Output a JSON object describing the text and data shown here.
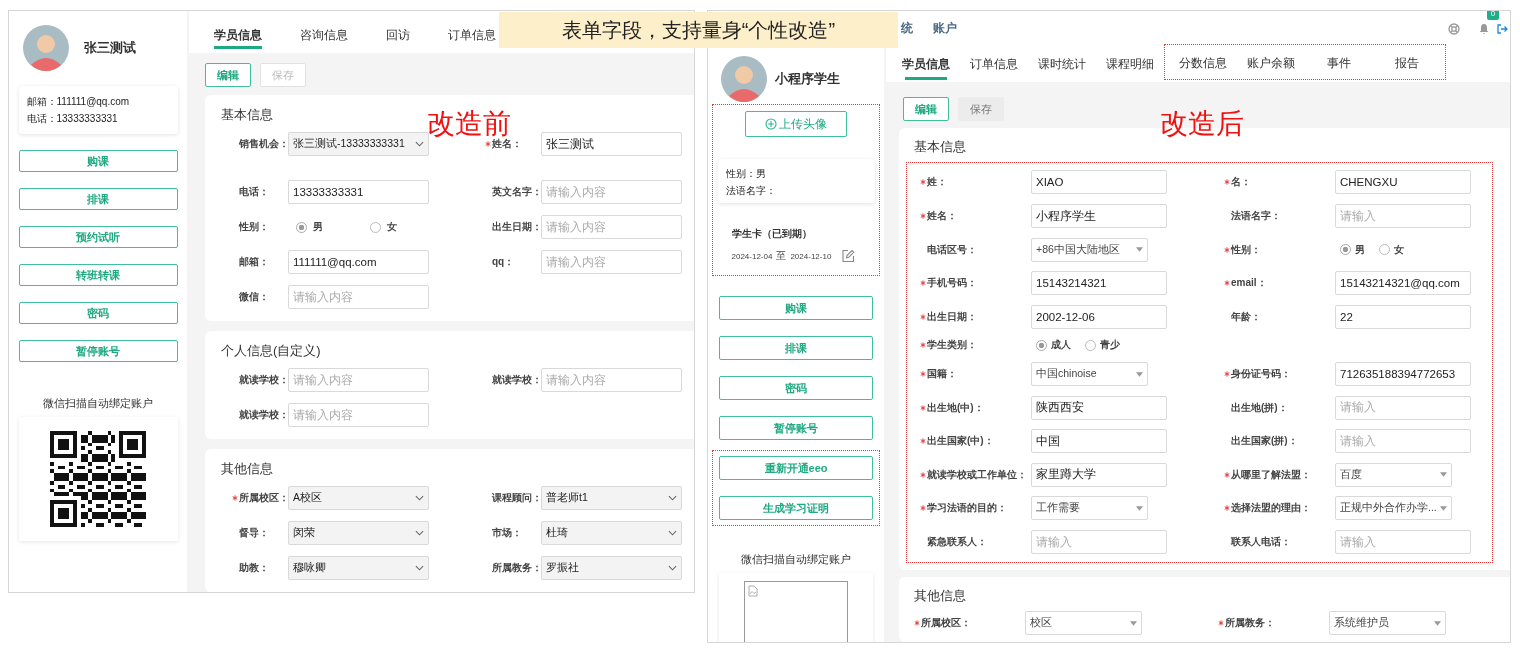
{
  "banner": {
    "text": "表单字段，支持量身“个性改造”"
  },
  "before": {
    "caption": "改造前",
    "profile": {
      "name": "张三测试",
      "info": [
        "邮箱：111111@qq.com",
        "电话：13333333331"
      ]
    },
    "buttons": [
      "购课",
      "排课",
      "预约试听",
      "转班转课",
      "密码",
      "暂停账号"
    ],
    "qr_caption": "微信扫描自动绑定账户",
    "tabs": [
      {
        "label": "学员信息",
        "selected": true
      },
      {
        "label": "咨询信息",
        "selected": false
      },
      {
        "label": "回访",
        "selected": false
      },
      {
        "label": "订单信息",
        "selected": false
      }
    ],
    "toolbar": [
      {
        "label": "编辑",
        "kind": "primary"
      },
      {
        "label": "保存",
        "kind": "disabled"
      }
    ],
    "sections": [
      {
        "title": "基本信息",
        "rows": [
          [
            {
              "label": "销售机会：",
              "kind": "select",
              "required": false,
              "value": "张三测试-13333333331"
            },
            {
              "label": "姓名：",
              "kind": "input",
              "required": true,
              "value": "张三测试"
            }
          ],
          [
            {
              "label": "电话：",
              "kind": "input",
              "required": false,
              "value": "13333333331"
            },
            {
              "label": "英文名字：",
              "kind": "input",
              "required": false,
              "placeholder": "请输入内容"
            }
          ],
          [
            {
              "label": "性别：",
              "kind": "radio",
              "required": false,
              "options": [
                {
                  "label": "男",
                  "selected": true
                },
                {
                  "label": "女",
                  "selected": false
                }
              ]
            },
            {
              "label": "出生日期：",
              "kind": "input",
              "required": false,
              "placeholder": "请输入内容"
            }
          ],
          [
            {
              "label": "邮箱：",
              "kind": "input",
              "required": false,
              "value": "111111@qq.com"
            },
            {
              "label": "qq：",
              "kind": "input",
              "required": false,
              "placeholder": "请输入内容"
            }
          ],
          [
            {
              "label": "微信：",
              "kind": "input",
              "required": false,
              "placeholder": "请输入内容"
            }
          ]
        ]
      },
      {
        "title": "个人信息(自定义)",
        "rows": [
          [
            {
              "label": "就读学校：",
              "kind": "input",
              "required": false,
              "placeholder": "请输入内容"
            },
            {
              "label": "就读学校：",
              "kind": "input",
              "required": false,
              "placeholder": "请输入内容"
            }
          ],
          [
            {
              "label": "就读学校：",
              "kind": "input",
              "required": false,
              "placeholder": "请输入内容"
            }
          ]
        ]
      },
      {
        "title": "其他信息",
        "rows": [
          [
            {
              "label": "所属校区：",
              "kind": "select",
              "required": true,
              "value": "A校区"
            },
            {
              "label": "课程顾问：",
              "kind": "select",
              "required": false,
              "value": "普老师t1"
            }
          ],
          [
            {
              "label": "督导：",
              "kind": "select",
              "required": false,
              "value": "闵荣"
            },
            {
              "label": "市场：",
              "kind": "select",
              "required": false,
              "value": "杜琦"
            }
          ],
          [
            {
              "label": "助教：",
              "kind": "select",
              "required": false,
              "value": "穆咏卿"
            },
            {
              "label": "所属教务：",
              "kind": "select",
              "required": false,
              "value": "罗振社"
            }
          ]
        ]
      }
    ]
  },
  "after": {
    "caption": "改造后",
    "top_nav": [
      "统",
      "账户"
    ],
    "notification_count": "0",
    "profile": {
      "name": "小程序学生"
    },
    "added_profile": {
      "upload_button": "上传头像",
      "info": [
        "性别：男",
        "法语名字："
      ],
      "card_title": "学生卡（已到期）",
      "card_start": "2024-12-04",
      "card_to": "至",
      "card_end": "2024-12-10"
    },
    "buttons": [
      "购课",
      "排课",
      "密码",
      "暂停账号"
    ],
    "added_buttons": [
      "重新开通eeo",
      "生成学习证明"
    ],
    "qr_caption": "微信扫描自动绑定账户",
    "tabs": [
      {
        "label": "学员信息",
        "selected": true
      },
      {
        "label": "订单信息",
        "selected": false
      },
      {
        "label": "课时统计",
        "selected": false
      },
      {
        "label": "课程明细",
        "selected": false
      }
    ],
    "added_tabs": [
      {
        "label": "分数信息",
        "selected": false
      },
      {
        "label": "账户余额",
        "selected": false
      },
      {
        "label": "事件",
        "selected": false
      },
      {
        "label": "报告",
        "selected": false
      }
    ],
    "toolbar": [
      {
        "label": "编辑",
        "kind": "primary"
      },
      {
        "label": "保存",
        "kind": "plain"
      }
    ],
    "sections": [
      {
        "title": "基本信息",
        "highlighted": true,
        "rows": [
          [
            {
              "label": "姓：",
              "kind": "input",
              "required": true,
              "value": "XIAO"
            },
            {
              "label": "名：",
              "kind": "input",
              "required": true,
              "value": "CHENGXU"
            }
          ],
          [
            {
              "label": "姓名：",
              "kind": "input",
              "required": true,
              "value": "小程序学生"
            },
            {
              "label": "法语名字：",
              "kind": "input",
              "required": false,
              "placeholder": "请输入"
            }
          ],
          [
            {
              "label": "电话区号：",
              "kind": "select",
              "required": false,
              "value": "+86中国大陆地区"
            },
            {
              "label": "性别：",
              "kind": "radio",
              "required": true,
              "options": [
                {
                  "label": "男",
                  "selected": true
                },
                {
                  "label": "女",
                  "selected": false
                }
              ]
            }
          ],
          [
            {
              "label": "手机号码：",
              "kind": "input",
              "required": true,
              "value": "15143214321"
            },
            {
              "label": "email：",
              "kind": "input",
              "required": true,
              "value": "15143214321@qq.com"
            }
          ],
          [
            {
              "label": "出生日期：",
              "kind": "input",
              "required": true,
              "value": "2002-12-06"
            },
            {
              "label": "年龄：",
              "kind": "input",
              "required": false,
              "value": "22"
            }
          ],
          [
            {
              "label": "学生类别：",
              "kind": "radio",
              "required": true,
              "options": [
                {
                  "label": "成人",
                  "selected": true
                },
                {
                  "label": "青少",
                  "selected": false
                }
              ]
            }
          ],
          [
            {
              "label": "国籍：",
              "kind": "select",
              "required": true,
              "value": "中国chinoise"
            },
            {
              "label": "身份证号码：",
              "kind": "input",
              "required": true,
              "value": "712635188394772653"
            }
          ],
          [
            {
              "label": "出生地(中)：",
              "kind": "input",
              "required": true,
              "value": "陕西西安"
            },
            {
              "label": "出生地(拼)：",
              "kind": "input",
              "required": false,
              "placeholder": "请输入"
            }
          ],
          [
            {
              "label": "出生国家(中)：",
              "kind": "input",
              "required": true,
              "value": "中国"
            },
            {
              "label": "出生国家(拼)：",
              "kind": "input",
              "required": false,
              "placeholder": "请输入"
            }
          ],
          [
            {
              "label": "就读学校或工作单位：",
              "kind": "input",
              "required": true,
              "value": "家里蹲大学"
            },
            {
              "label": "从哪里了解法盟：",
              "kind": "select",
              "required": true,
              "value": "百度"
            }
          ],
          [
            {
              "label": "学习法语的目的：",
              "kind": "select",
              "required": true,
              "value": "工作需要"
            },
            {
              "label": "选择法盟的理由：",
              "kind": "select",
              "required": true,
              "value": "正规中外合作办学..."
            }
          ],
          [
            {
              "label": "紧急联系人：",
              "kind": "input",
              "required": false,
              "placeholder": "请输入"
            },
            {
              "label": "联系人电话：",
              "kind": "input",
              "required": false,
              "placeholder": "请输入"
            }
          ]
        ]
      },
      {
        "title": "其他信息",
        "highlighted": false,
        "rows": [
          [
            {
              "label": "所属校区：",
              "kind": "select",
              "required": true,
              "value": "校区"
            },
            {
              "label": "所属教务：",
              "kind": "select",
              "required": true,
              "value": "系统维护员"
            }
          ]
        ]
      }
    ]
  }
}
